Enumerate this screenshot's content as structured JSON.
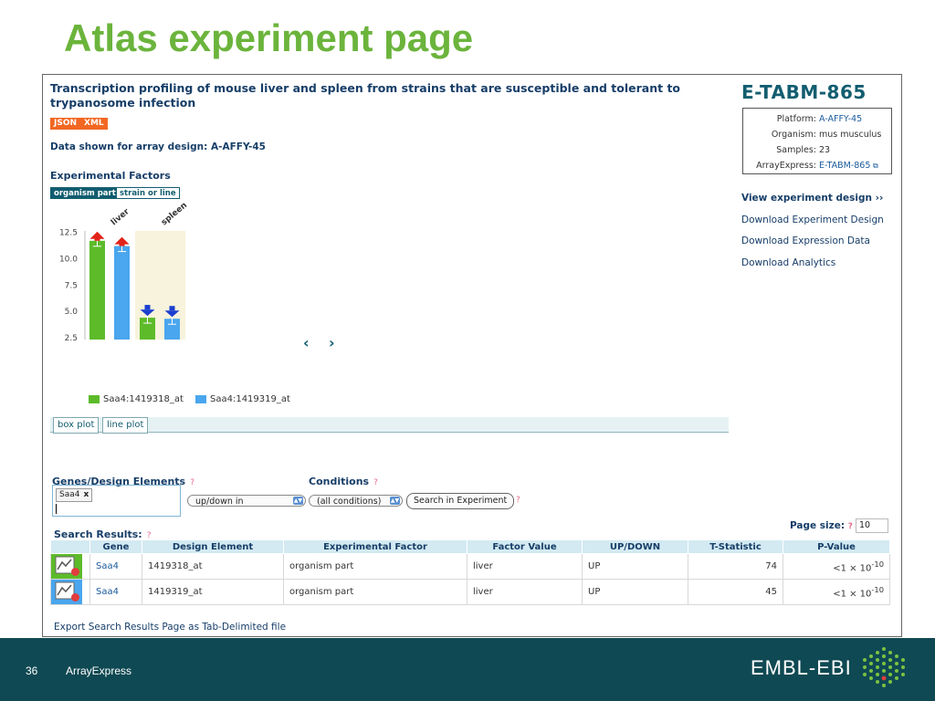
{
  "slide": {
    "title": "Atlas experiment page",
    "page_number": "36",
    "footer_brand": "ArrayExpress",
    "logo_text": "EMBL-EBI"
  },
  "experiment": {
    "title": "Transcription profiling of mouse liver and spleen from strains that are susceptible and tolerant to trypanosome infection",
    "format_buttons": [
      "JSON",
      "XML"
    ],
    "data_shown": "Data shown for array design: A-AFFY-45",
    "factors_heading": "Experimental Factors",
    "factor_tabs": [
      "organism part",
      "strain or line"
    ],
    "plot_tabs": [
      "box plot",
      "line plot"
    ],
    "nav_prev": "‹",
    "nav_next": "›"
  },
  "sidebar": {
    "accession": "E-TABM-865",
    "info": [
      {
        "key": "Platform:",
        "value": "A-AFFY-45"
      },
      {
        "key": "Organism:",
        "value": "mus musculus"
      },
      {
        "key": "Samples:",
        "value": "23"
      },
      {
        "key": "ArrayExpress:",
        "value": "E-TABM-865"
      }
    ],
    "view_design": "View experiment design ››",
    "links": [
      "Download Experiment Design",
      "Download Expression Data",
      "Download Analytics"
    ]
  },
  "chart_data": {
    "type": "bar",
    "categories": [
      "liver",
      "spleen"
    ],
    "series": [
      {
        "name": "Saa4:1419318_at",
        "color": "#5dbb2a",
        "values": [
          11.7,
          4.4
        ],
        "direction": [
          "up",
          "down"
        ]
      },
      {
        "name": "Saa4:1419319_at",
        "color": "#4aa6ee",
        "values": [
          11.2,
          4.3
        ],
        "direction": [
          "up",
          "down"
        ]
      }
    ],
    "yticks": [
      "12.5",
      "10.0",
      "7.5",
      "5.0",
      "2.5"
    ],
    "ylim": [
      2.5,
      12.5
    ],
    "title": "",
    "xlabel": "",
    "ylabel": ""
  },
  "search": {
    "genes_label": "Genes/Design Elements",
    "conditions_label": "Conditions",
    "help": "?",
    "gene_tag": "Saa4",
    "gene_tag_remove": "x",
    "updown_value": "up/down in",
    "conditions_value": "(all conditions)",
    "search_button": "Search in Experiment",
    "results_label": "Search Results:",
    "page_size_label": "Page size:",
    "page_size_value": "10",
    "export_link": "Export Search Results Page as Tab-Delimited file"
  },
  "results": {
    "columns": [
      "",
      "Gene",
      "Design Element",
      "Experimental Factor",
      "Factor Value",
      "UP/DOWN",
      "T-Statistic",
      "P-Value"
    ],
    "rows": [
      {
        "gene": "Saa4",
        "design_element": "1419318_at",
        "factor": "organism part",
        "factor_value": "liver",
        "updown": "UP",
        "t_stat": "74",
        "p_value": "<1 × 10",
        "p_exp": "-10",
        "icon_color": "#5dbb2a"
      },
      {
        "gene": "Saa4",
        "design_element": "1419319_at",
        "factor": "organism part",
        "factor_value": "liver",
        "updown": "UP",
        "t_stat": "45",
        "p_value": "<1 × 10",
        "p_exp": "-10",
        "icon_color": "#4aa6ee"
      }
    ]
  }
}
